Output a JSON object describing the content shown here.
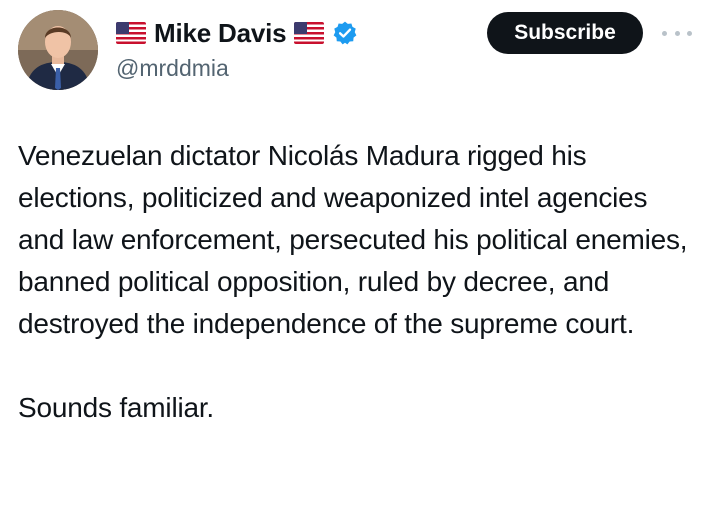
{
  "author": {
    "name": "Mike Davis",
    "handle": "@mrddmia",
    "flag_before_name": "us-flag-icon",
    "flag_after_name": "us-flag-icon",
    "verified_badge": "verified-badge-icon",
    "verified_color": "#1d9bf0"
  },
  "actions": {
    "subscribe_label": "Subscribe",
    "more_icon": "more-dots-icon"
  },
  "tweet": {
    "paragraphs": [
      "Venezuelan dictator Nicolás Madura rigged his elections, politicized and weaponized intel agencies and law enforcement, persecuted his political enemies, banned political opposition, ruled by decree, and destroyed the independence of the supreme court.",
      "Sounds familiar."
    ]
  }
}
